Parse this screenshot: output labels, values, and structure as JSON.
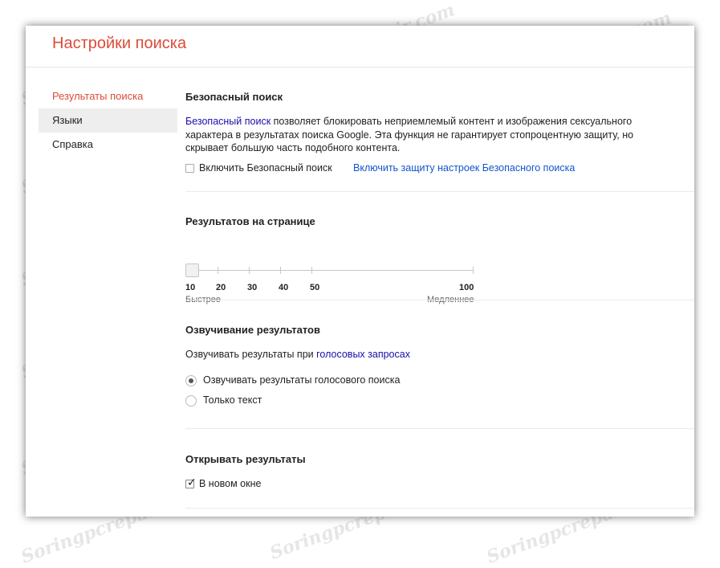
{
  "page": {
    "title": "Настройки поиска"
  },
  "sidebar": {
    "items": [
      {
        "label": "Результаты поиска"
      },
      {
        "label": "Языки"
      },
      {
        "label": "Справка"
      }
    ]
  },
  "safe_search": {
    "title": "Безопасный поиск",
    "desc_link": "Безопасный поиск",
    "desc_line1_rest": " позволяет блокировать неприемлемый контент и изображения сексуального",
    "desc_line2": "характера в результатах поиска Google. Эта функция не гарантирует стопроцентную защиту, но",
    "desc_line3": "скрывает большую часть подобного контента.",
    "checkbox_label": "Включить Безопасный поиск",
    "checkbox_checked": false,
    "lock_link": "Включить защиту настроек Безопасного поиска"
  },
  "results_per_page": {
    "title": "Результатов на странице",
    "ticks": [
      "10",
      "20",
      "30",
      "40",
      "50",
      "100"
    ],
    "selected": "10",
    "faster_label": "Быстрее",
    "slower_label": "Медленнее"
  },
  "voice": {
    "title": "Озвучивание результатов",
    "desc_prefix": "Озвучивать результаты при ",
    "desc_link": "голосовых запросах",
    "options": [
      {
        "label": "Озвучивать результаты голосового поиска",
        "selected": true
      },
      {
        "label": "Только текст",
        "selected": false
      }
    ]
  },
  "open_results": {
    "title": "Открывать результаты",
    "checkbox_label": "В новом окне",
    "checkbox_checked": true
  },
  "watermark": {
    "text": "Soringpcrepair.com"
  },
  "colors": {
    "accent": "#dd4b39",
    "link": "#1a0dab"
  }
}
